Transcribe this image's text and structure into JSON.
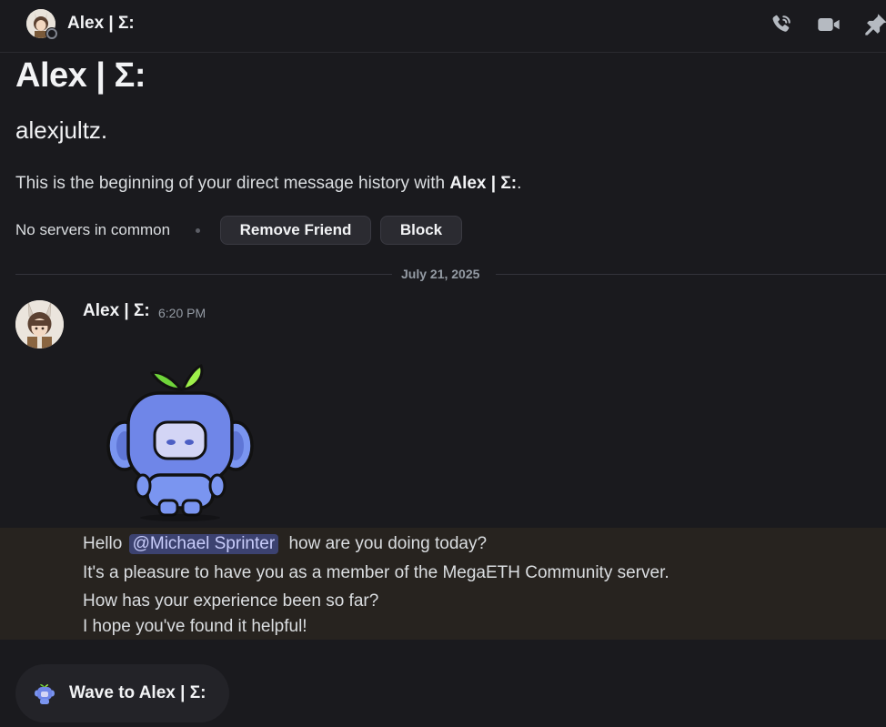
{
  "header": {
    "title": "Alex | Σ:",
    "icons": [
      "phone-call-icon",
      "video-camera-icon",
      "pin-icon"
    ]
  },
  "profile": {
    "display_name": "Alex | Σ:",
    "username": "alexjultz.",
    "intro_prefix": "This is the beginning of your direct message history with ",
    "intro_name": "Alex | Σ:",
    "intro_suffix": ".",
    "servers_text": "No servers in common",
    "remove_friend_label": "Remove Friend",
    "block_label": "Block"
  },
  "divider": {
    "date": "July 21, 2025"
  },
  "message": {
    "author": "Alex | Σ:",
    "time": "6:20 PM",
    "sticker": "wumpus-wave-sticker",
    "line1_prefix": "Hello",
    "mention": "@Michael Sprinter",
    "line1_suffix": "how are you doing today?",
    "line2": "It's a pleasure to have you as a member of the MegaETH Community server.",
    "line3": "How has your experience been so far?",
    "line4": "I hope you've found it helpful!"
  },
  "wave_button": {
    "label": "Wave to Alex | Σ:"
  },
  "colors": {
    "background": "#1a1a1e",
    "mention_bg": "#3c4270",
    "mention_text": "#c9cdfb",
    "highlight_bg": "#27231f",
    "wumpus_blue": "#6f86e8"
  }
}
